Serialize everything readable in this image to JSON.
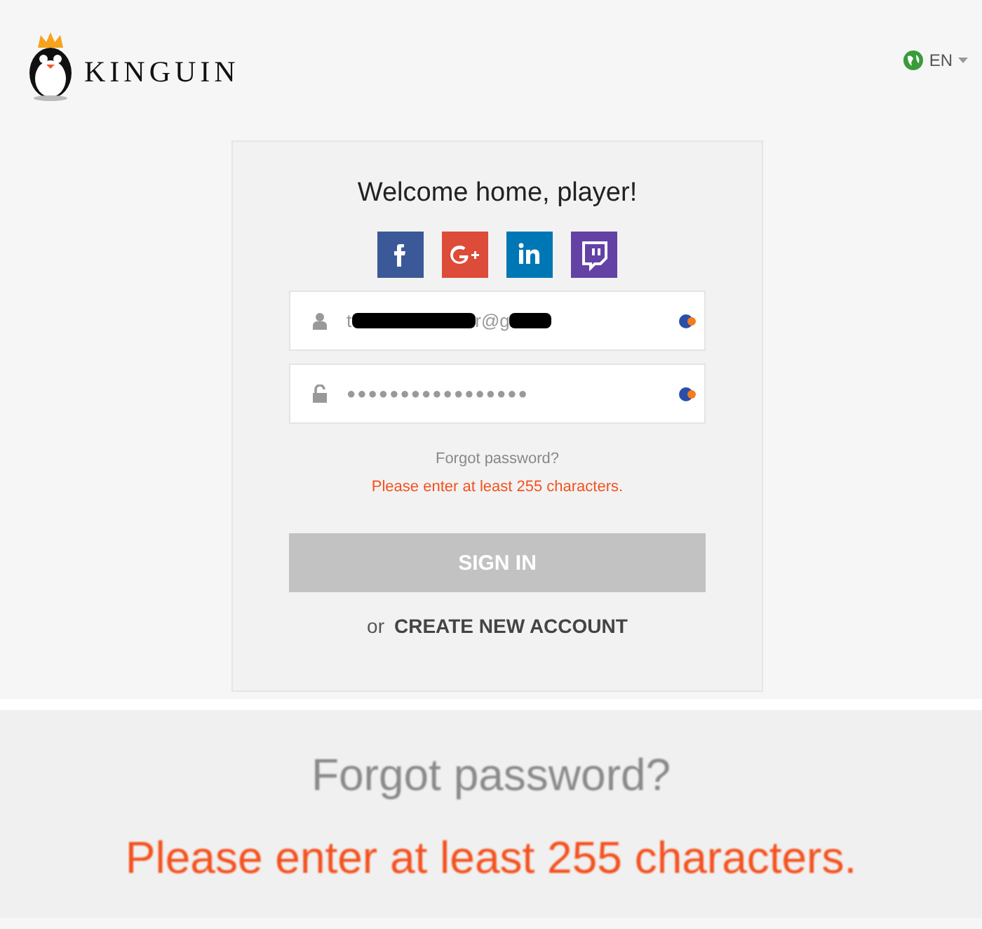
{
  "header": {
    "logo_text": "KINGUIN",
    "language": "EN"
  },
  "login": {
    "title": "Welcome home, player!",
    "social_buttons": [
      {
        "kind": "facebook",
        "color": "#3b5998"
      },
      {
        "kind": "google",
        "color": "#dd4b39"
      },
      {
        "kind": "linkedin",
        "color": "#0077b5"
      },
      {
        "kind": "twitch",
        "color": "#6441a5"
      }
    ],
    "email_field": {
      "visible_parts": [
        "t",
        "r@g"
      ],
      "redacted": true
    },
    "password_field": {
      "value": "●●●●●●●●●●●●●●●●●"
    },
    "forgot_link": "Forgot password?",
    "error": "Please enter at least 255 characters.",
    "sign_in_button": {
      "label": "SIGN IN",
      "disabled": true
    },
    "or_text": "or",
    "create_link": "CREATE NEW ACCOUNT"
  },
  "zoom_inset": {
    "lines": [
      {
        "kind": "link",
        "text": "Forgot password?"
      },
      {
        "kind": "error",
        "text": "Please enter at least 255 characters."
      }
    ]
  }
}
